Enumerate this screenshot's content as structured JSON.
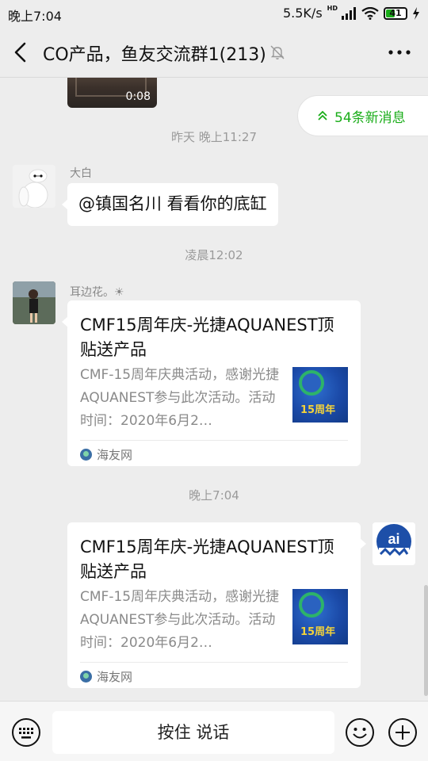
{
  "status_bar": {
    "time": "晚上7:04",
    "network_speed": "5.5K/s",
    "hd_label": "HD",
    "battery_level": "41"
  },
  "header": {
    "title": "CO产品，鱼友交流群1(213)",
    "back_icon": "back-chevron-icon",
    "mute_icon": "bell-muted-icon",
    "more_icon": "more-dots-icon"
  },
  "new_messages": {
    "label": "54条新消息"
  },
  "video": {
    "duration": "0:08"
  },
  "messages": [
    {
      "timestamp": "昨天 晚上11:27",
      "sender": "大白",
      "text": "@镇国名川  看看你的底缸"
    },
    {
      "timestamp": "凌晨12:02",
      "sender": "耳边花。☀",
      "card": {
        "title": "CMF15周年庆-光捷AQUANEST顶贴送产品",
        "description": "CMF-15周年庆典活动，感谢光捷AQUANEST参与此次活动。活动时间：2020年6月2…",
        "thumb_text": "15周年",
        "source": "海友网"
      }
    },
    {
      "timestamp": "晚上7:04",
      "card": {
        "title": "CMF15周年庆-光捷AQUANEST顶贴送产品",
        "description": "CMF-15周年庆典活动，感谢光捷AQUANEST参与此次活动。活动时间：2020年6月2…",
        "thumb_text": "15周年",
        "source": "海友网"
      }
    }
  ],
  "input_bar": {
    "hold_to_talk": "按住 说话",
    "keyboard_icon": "keyboard-icon",
    "emoji_icon": "emoji-icon",
    "plus_icon": "plus-circle-icon"
  },
  "colors": {
    "accent": "#1AAD19",
    "background": "#EDEDED"
  }
}
